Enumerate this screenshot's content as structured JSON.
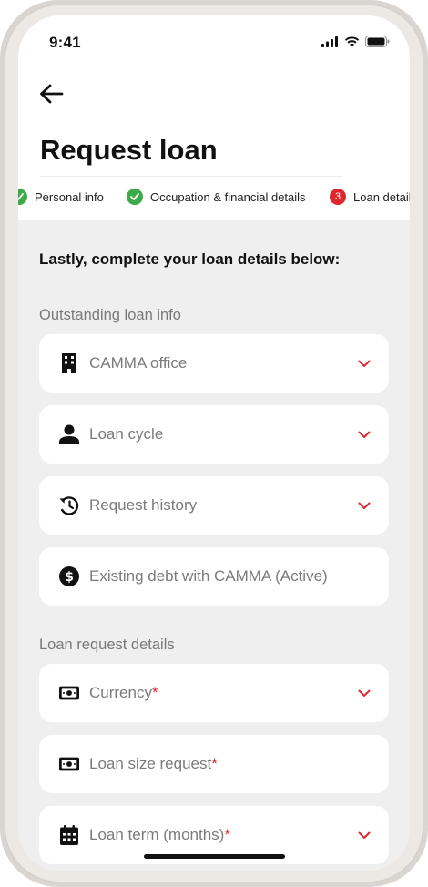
{
  "status_bar": {
    "time": "9:41"
  },
  "header": {
    "title": "Request loan"
  },
  "stepper": {
    "steps": [
      {
        "label": "Personal info",
        "state": "done"
      },
      {
        "label": "Occupation & financial details",
        "state": "done"
      },
      {
        "label": "Loan details",
        "number": "3",
        "state": "active"
      }
    ]
  },
  "form": {
    "lead": "Lastly, complete your loan details below:",
    "outstanding": {
      "heading": "Outstanding loan info",
      "fields": [
        {
          "label": "CAMMA office",
          "icon": "building-icon",
          "dropdown": true
        },
        {
          "label": "Loan cycle",
          "icon": "person-icon",
          "dropdown": true
        },
        {
          "label": "Request history",
          "icon": "history-icon",
          "dropdown": true
        },
        {
          "label": "Existing debt with CAMMA (Active)",
          "icon": "dollar-circle-icon",
          "dropdown": false
        }
      ]
    },
    "request": {
      "heading": "Loan request details",
      "fields": [
        {
          "label": "Currency",
          "required_mark": "*",
          "icon": "banknote-icon",
          "dropdown": true
        },
        {
          "label": "Loan size request",
          "required_mark": "*",
          "icon": "banknote-icon",
          "dropdown": false
        },
        {
          "label": "Loan term (months)",
          "required_mark": "*",
          "icon": "calendar-icon",
          "dropdown": true
        }
      ]
    }
  },
  "colors": {
    "accent": "#e0262d",
    "success": "#3daa4a",
    "panel": "#efefef",
    "muted_text": "#7b7b7b"
  }
}
